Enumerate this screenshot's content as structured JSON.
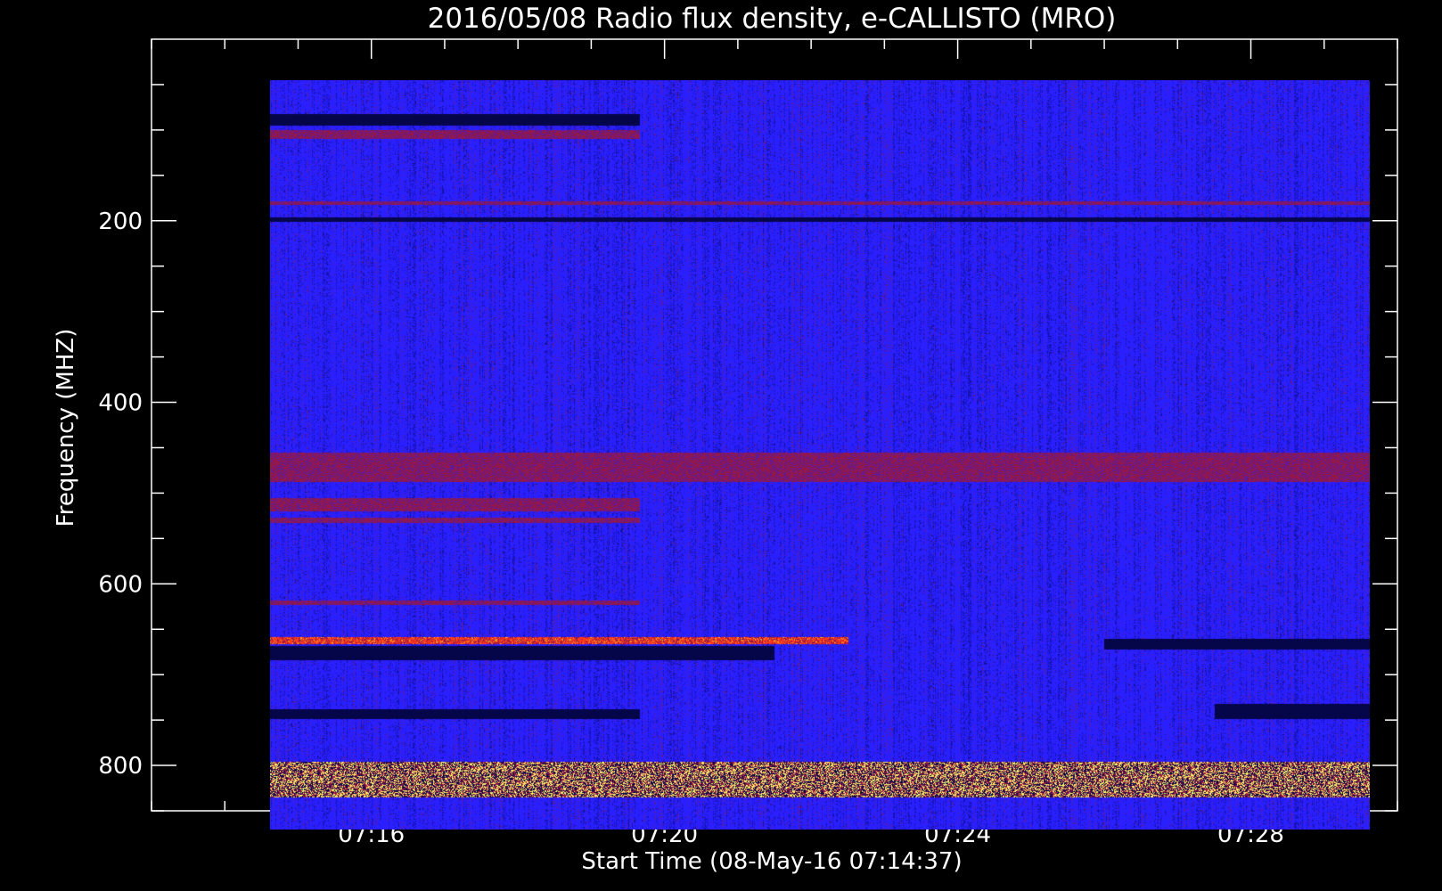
{
  "chart_data": {
    "type": "heatmap",
    "title": "2016/05/08  Radio flux density, e-CALLISTO (MRO)",
    "xlabel": "Start Time (08-May-16 07:14:37)",
    "ylabel": "Frequency (MHZ)",
    "x_ticks": [
      "07:16",
      "07:20",
      "07:24",
      "07:28"
    ],
    "y_ticks": [
      200,
      400,
      600,
      800
    ],
    "xlim": [
      "07:13:00",
      "07:30:00"
    ],
    "ylim": [
      850,
      0
    ],
    "data_x_range": [
      "07:14:37",
      "07:29:37"
    ],
    "data_y_range": [
      45,
      870
    ],
    "colors": {
      "background": "#000000",
      "base": "#2a1fff",
      "dark": "#05054a",
      "warm": "#8a1a55",
      "hot": "#ff3a1a",
      "hottest": "#ffee66"
    },
    "features": [
      {
        "name": "dark band",
        "freq": [
          82,
          95
        ],
        "time": [
          "07:14:37",
          "07:19:40"
        ],
        "level": "dark"
      },
      {
        "name": "red band",
        "freq": [
          100,
          110
        ],
        "time": [
          "07:14:37",
          "07:19:40"
        ],
        "level": "warm"
      },
      {
        "name": "interference line",
        "freq": [
          178,
          182
        ],
        "time": [
          "07:14:37",
          "07:29:37"
        ],
        "level": "warm"
      },
      {
        "name": "interference line",
        "freq": [
          196,
          201
        ],
        "time": [
          "07:14:37",
          "07:29:37"
        ],
        "level": "dark"
      },
      {
        "name": "interference band",
        "freq": [
          455,
          487
        ],
        "time": [
          "07:14:37",
          "07:29:37"
        ],
        "level": "warm"
      },
      {
        "name": "red band",
        "freq": [
          505,
          520
        ],
        "time": [
          "07:14:37",
          "07:19:40"
        ],
        "level": "warm"
      },
      {
        "name": "red band",
        "freq": [
          527,
          533
        ],
        "time": [
          "07:14:37",
          "07:19:40"
        ],
        "level": "warm"
      },
      {
        "name": "red band",
        "freq": [
          618,
          623
        ],
        "time": [
          "07:14:37",
          "07:19:40"
        ],
        "level": "warm"
      },
      {
        "name": "red band",
        "freq": [
          658,
          666
        ],
        "time": [
          "07:14:37",
          "07:22:30"
        ],
        "level": "hot"
      },
      {
        "name": "dark band",
        "freq": [
          668,
          684
        ],
        "time": [
          "07:14:37",
          "07:21:30"
        ],
        "level": "dark"
      },
      {
        "name": "dark band",
        "freq": [
          660,
          672
        ],
        "time": [
          "07:26:00",
          "07:29:37"
        ],
        "level": "dark"
      },
      {
        "name": "dark band",
        "freq": [
          738,
          748
        ],
        "time": [
          "07:14:37",
          "07:19:40"
        ],
        "level": "dark"
      },
      {
        "name": "dark band",
        "freq": [
          732,
          748
        ],
        "time": [
          "07:27:30",
          "07:29:37"
        ],
        "level": "dark"
      },
      {
        "name": "hot band",
        "freq": [
          795,
          835
        ],
        "time": [
          "07:14:37",
          "07:29:37"
        ],
        "level": "hottest"
      }
    ]
  }
}
